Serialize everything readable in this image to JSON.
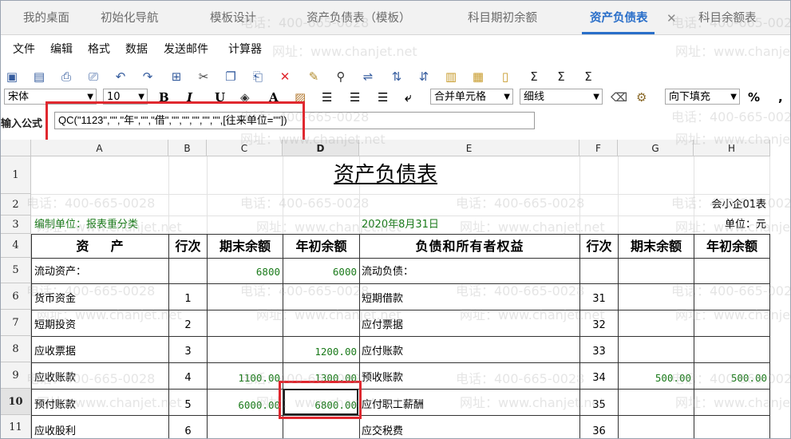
{
  "tabs": [
    {
      "label": "我的桌面",
      "active": false
    },
    {
      "label": "初始化导航",
      "active": false
    },
    {
      "label": "模板设计",
      "active": false
    },
    {
      "label": "资产负债表（模板）",
      "active": false
    },
    {
      "label": "科目期初余额",
      "active": false
    },
    {
      "label": "资产负债表",
      "active": true
    },
    {
      "label": "科目余额表",
      "active": false
    }
  ],
  "tab_close": "✕",
  "menu": [
    "文件",
    "编辑",
    "格式",
    "数据",
    "发送邮件",
    "计算器"
  ],
  "toolbar2": {
    "font": "宋体",
    "size": "10",
    "bold": "B",
    "italic": "I",
    "underline": "U",
    "fontcolor": "A",
    "merge": "合并单元格",
    "border": "细线",
    "fill": "向下填充",
    "percent": "%",
    "comma": ","
  },
  "formula": {
    "label": "输入公式",
    "value": "QC(\"1123\",\"\",\"年\",\"\",\"借\",\"\",\"\",\"\",\"\",\"\",[往来单位=\"\"])"
  },
  "columns": [
    "A",
    "B",
    "C",
    "D",
    "E",
    "F",
    "G",
    "H"
  ],
  "rows": [
    "1",
    "2",
    "3",
    "4",
    "5",
    "6",
    "7",
    "8",
    "9",
    "10",
    "11"
  ],
  "sheet": {
    "title": "资产负债表",
    "form_code": "会小企01表",
    "unit_prefix": "编制单位：报表重分类",
    "date": "2020年8月31日",
    "currency_unit": "单位：元",
    "headers": {
      "asset": "资    产",
      "line": "行次",
      "end_balance": "期末余额",
      "begin_balance": "年初余额",
      "liability": "负债和所有者权益",
      "line2": "行次",
      "end_balance2": "期末余额",
      "begin_balance2": "年初余额"
    },
    "body": [
      {
        "a": "流动资产：",
        "b": "",
        "c": "6800",
        "d": "6000",
        "e": "流动负债：",
        "f": "",
        "g": "",
        "h": ""
      },
      {
        "a": "货币资金",
        "b": "1",
        "c": "",
        "d": "",
        "e": "短期借款",
        "f": "31",
        "g": "",
        "h": ""
      },
      {
        "a": "短期投资",
        "b": "2",
        "c": "",
        "d": "",
        "e": "应付票据",
        "f": "32",
        "g": "",
        "h": ""
      },
      {
        "a": "应收票据",
        "b": "3",
        "c": "",
        "d": "1200.00",
        "e": "应付账款",
        "f": "33",
        "g": "",
        "h": ""
      },
      {
        "a": "应收账款",
        "b": "4",
        "c": "1100.00",
        "d": "1300.00",
        "e": "预收账款",
        "f": "34",
        "g": "500.00",
        "h": "500.00"
      },
      {
        "a": "预付账款",
        "b": "5",
        "c": "6000.00",
        "d": "6800.00",
        "e": "应付职工薪酬",
        "f": "35",
        "g": "",
        "h": ""
      },
      {
        "a": "应收股利",
        "b": "6",
        "c": "",
        "d": "",
        "e": "应交税费",
        "f": "36",
        "g": "",
        "h": ""
      }
    ]
  },
  "watermark": {
    "phone": "电话：400-665-0028",
    "site": "网址：www.chanjet.net"
  },
  "colors": {
    "accent": "#2a6fc9",
    "highlight": "#e0282f",
    "value_green": "#1a7a1a"
  }
}
